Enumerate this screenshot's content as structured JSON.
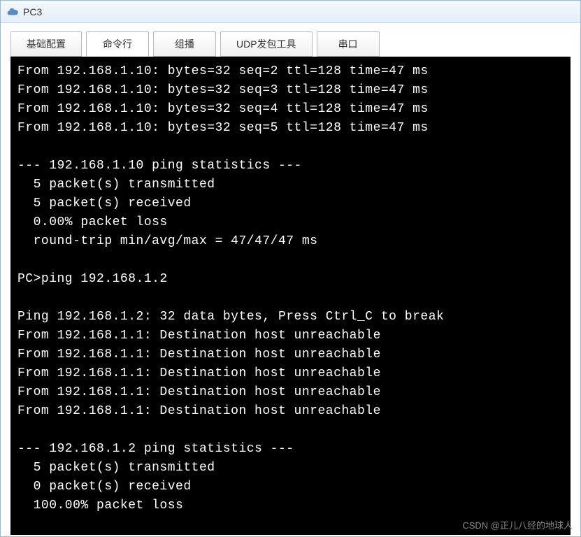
{
  "window": {
    "title": "PC3"
  },
  "tabs": [
    {
      "label": "基础配置",
      "active": false
    },
    {
      "label": "命令行",
      "active": true
    },
    {
      "label": "组播",
      "active": false
    },
    {
      "label": "UDP发包工具",
      "active": false
    },
    {
      "label": "串口",
      "active": false
    }
  ],
  "terminal": {
    "lines": [
      "From 192.168.1.10: bytes=32 seq=2 ttl=128 time=47 ms",
      "From 192.168.1.10: bytes=32 seq=3 ttl=128 time=47 ms",
      "From 192.168.1.10: bytes=32 seq=4 ttl=128 time=47 ms",
      "From 192.168.1.10: bytes=32 seq=5 ttl=128 time=47 ms",
      "",
      "--- 192.168.1.10 ping statistics ---",
      "  5 packet(s) transmitted",
      "  5 packet(s) received",
      "  0.00% packet loss",
      "  round-trip min/avg/max = 47/47/47 ms",
      "",
      "PC>ping 192.168.1.2",
      "",
      "Ping 192.168.1.2: 32 data bytes, Press Ctrl_C to break",
      "From 192.168.1.1: Destination host unreachable",
      "From 192.168.1.1: Destination host unreachable",
      "From 192.168.1.1: Destination host unreachable",
      "From 192.168.1.1: Destination host unreachable",
      "From 192.168.1.1: Destination host unreachable",
      "",
      "--- 192.168.1.2 ping statistics ---",
      "  5 packet(s) transmitted",
      "  0 packet(s) received",
      "  100.00% packet loss"
    ]
  },
  "watermark": "CSDN @正儿八经的地球人"
}
